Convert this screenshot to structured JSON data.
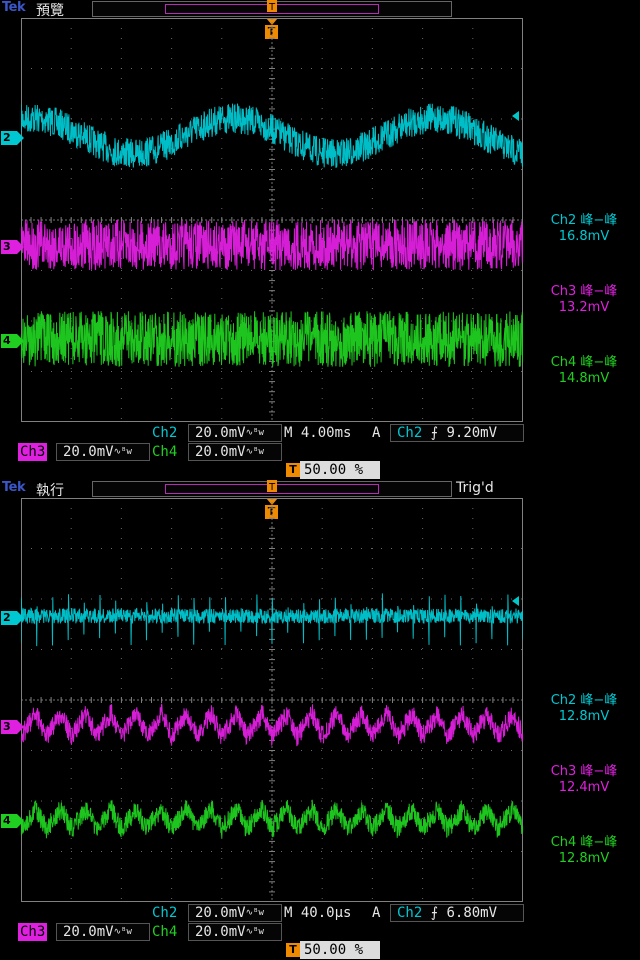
{
  "brand": "Tek",
  "colors": {
    "ch2": "#00c8d2",
    "ch3": "#e020e0",
    "ch4": "#20d020",
    "trigger": "#f08a00",
    "grid": "#808080"
  },
  "screens": [
    {
      "mode": "預覽",
      "trig_status": "",
      "trigger_marker": "T",
      "ch_markers": [
        "2",
        "3",
        "4"
      ],
      "measurements": [
        {
          "label": "Ch2 峰−峰",
          "value": "16.8mV"
        },
        {
          "label": "Ch3 峰−峰",
          "value": "13.2mV"
        },
        {
          "label": "Ch4 峰−峰",
          "value": "14.8mV"
        }
      ],
      "status": {
        "ch2_label": "Ch2",
        "ch2_scale": "20.0mV",
        "ch3_label": "Ch3",
        "ch3_scale": "20.0mV",
        "ch4_label": "Ch4",
        "ch4_scale": "20.0mV",
        "bw_symbol": "∿ᴮw",
        "timebase": "M 4.00ms",
        "trig_mode": "A",
        "trig_src": "Ch2",
        "trig_slope": "⨍",
        "trig_level": "9.20mV",
        "position_label": "T",
        "position": "50.00 %"
      },
      "waveforms": {
        "ch2": {
          "shape": "sine",
          "cycles": 2.5,
          "amplitude_divs": 0.35,
          "noise_divs": 0.3
        },
        "ch3": {
          "shape": "noise",
          "noise_divs": 0.5
        },
        "ch4": {
          "shape": "noise",
          "noise_divs": 0.55
        }
      }
    },
    {
      "mode": "執行",
      "trig_status": "Trig'd",
      "trigger_marker": "T",
      "ch_markers": [
        "2",
        "3",
        "4"
      ],
      "measurements": [
        {
          "label": "Ch2 峰−峰",
          "value": "12.8mV"
        },
        {
          "label": "Ch3 峰−峰",
          "value": "12.4mV"
        },
        {
          "label": "Ch4 峰−峰",
          "value": "12.8mV"
        }
      ],
      "status": {
        "ch2_label": "Ch2",
        "ch2_scale": "20.0mV",
        "ch3_label": "Ch3",
        "ch3_scale": "20.0mV",
        "ch4_label": "Ch4",
        "ch4_scale": "20.0mV",
        "bw_symbol": "∿ᴮw",
        "timebase": "M 40.0µs",
        "trig_mode": "A",
        "trig_src": "Ch2",
        "trig_slope": "⨍",
        "trig_level": "6.80mV",
        "position_label": "T",
        "position": "50.00 %"
      },
      "waveforms": {
        "ch2": {
          "shape": "spikes",
          "cycles": 32,
          "amplitude_divs": 0.25,
          "noise_divs": 0.15
        },
        "ch3": {
          "shape": "sawtooth",
          "cycles": 20,
          "amplitude_divs": 0.45,
          "noise_divs": 0.2
        },
        "ch4": {
          "shape": "sawtooth",
          "cycles": 20,
          "amplitude_divs": 0.4,
          "noise_divs": 0.2
        }
      }
    }
  ]
}
